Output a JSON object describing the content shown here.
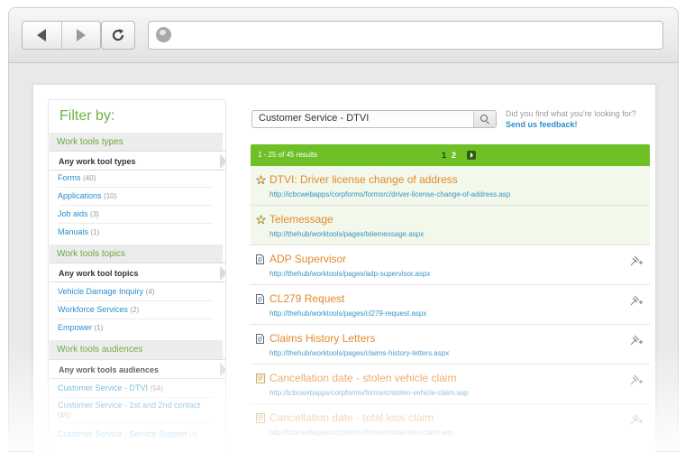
{
  "browser": {
    "back_icon": "back-arrow-icon",
    "forward_icon": "forward-arrow-icon",
    "reload_icon": "reload-icon",
    "globe_icon": "globe-icon",
    "address": ""
  },
  "sidebar": {
    "title": "Filter by:",
    "sections": [
      {
        "heading": "Work tools types",
        "selected": "Any work tool types",
        "items": [
          {
            "label": "Forms",
            "count": "(40)"
          },
          {
            "label": "Applications",
            "count": "(10)"
          },
          {
            "label": "Job aids",
            "count": "(3)"
          },
          {
            "label": "Manuals",
            "count": "(1)"
          }
        ]
      },
      {
        "heading": "Work tools topics",
        "selected": "Any work tool topics",
        "items": [
          {
            "label": "Vehicle Damage Inquiry",
            "count": "(4)"
          },
          {
            "label": "Workforce Services",
            "count": "(2)"
          },
          {
            "label": "Empower",
            "count": "(1)"
          }
        ]
      },
      {
        "heading": "Work tools audiences",
        "selected": "Any work tools audiences",
        "items": [
          {
            "label": "Customer Service - DTVI",
            "count": "(54)"
          },
          {
            "label": "Customer Service - 1st and 2nd contact",
            "count": "(45)"
          },
          {
            "label": "Customer Service - Service Support",
            "count": "(4)"
          }
        ]
      }
    ]
  },
  "search": {
    "value": "Customer Service - DTVI",
    "button_icon": "search-icon"
  },
  "feedback": {
    "question": "Did you find what you're looking for?",
    "link": "Send us feedback!"
  },
  "results_bar": {
    "summary": "1 - 25 of 45 results",
    "pages": [
      "1",
      "2"
    ],
    "current_page": "1",
    "next_icon": "next-page-icon"
  },
  "results": [
    {
      "title": "DTVI: Driver license change of address",
      "url": "http://icbcwebapps/corpforms/formsrc/driver-license-change-of-address.asp",
      "icon": "star-icon",
      "favorite": true
    },
    {
      "title": "Telemessage",
      "url": "http://thehub/worktools/pages/telemessage.aspx",
      "icon": "star-icon",
      "favorite": true
    },
    {
      "title": "ADP Supervisor",
      "url": "http://thehub/worktools/pages/adp-supervisor.aspx",
      "icon": "document-icon",
      "favorite": false
    },
    {
      "title": "CL279 Request",
      "url": "http://thehub/worktools/pages/cl279-request.aspx",
      "icon": "document-icon",
      "favorite": false
    },
    {
      "title": "Claims History Letters",
      "url": "http://thehub/worktools/pages/claims-history-letters.aspx",
      "icon": "document-icon",
      "favorite": false
    },
    {
      "title": "Cancellation date - stolen vehicle claim",
      "url": "http://icbcwebapps/corpforms/formsrc/stolen-vehicle-claim.asp",
      "icon": "form-icon",
      "favorite": false
    },
    {
      "title": "Cancellation date - total loss claim",
      "url": "http://icbcwebapps/corpforms/formsrc/total-loss-claim.asp",
      "icon": "form-icon",
      "favorite": false
    }
  ],
  "colors": {
    "brand_green": "#6fbf26",
    "title_orange": "#e38a2e",
    "link_blue": "#2a8fcf"
  }
}
